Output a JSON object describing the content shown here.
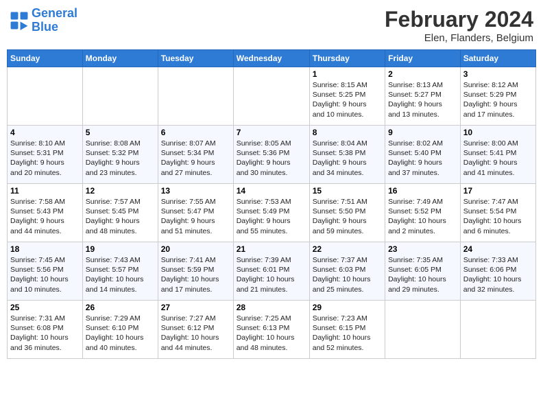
{
  "header": {
    "logo_line1": "General",
    "logo_line2": "Blue",
    "month": "February 2024",
    "location": "Elen, Flanders, Belgium"
  },
  "days_of_week": [
    "Sunday",
    "Monday",
    "Tuesday",
    "Wednesday",
    "Thursday",
    "Friday",
    "Saturday"
  ],
  "weeks": [
    [
      {
        "day": "",
        "info": ""
      },
      {
        "day": "",
        "info": ""
      },
      {
        "day": "",
        "info": ""
      },
      {
        "day": "",
        "info": ""
      },
      {
        "day": "1",
        "info": "Sunrise: 8:15 AM\nSunset: 5:25 PM\nDaylight: 9 hours\nand 10 minutes."
      },
      {
        "day": "2",
        "info": "Sunrise: 8:13 AM\nSunset: 5:27 PM\nDaylight: 9 hours\nand 13 minutes."
      },
      {
        "day": "3",
        "info": "Sunrise: 8:12 AM\nSunset: 5:29 PM\nDaylight: 9 hours\nand 17 minutes."
      }
    ],
    [
      {
        "day": "4",
        "info": "Sunrise: 8:10 AM\nSunset: 5:31 PM\nDaylight: 9 hours\nand 20 minutes."
      },
      {
        "day": "5",
        "info": "Sunrise: 8:08 AM\nSunset: 5:32 PM\nDaylight: 9 hours\nand 23 minutes."
      },
      {
        "day": "6",
        "info": "Sunrise: 8:07 AM\nSunset: 5:34 PM\nDaylight: 9 hours\nand 27 minutes."
      },
      {
        "day": "7",
        "info": "Sunrise: 8:05 AM\nSunset: 5:36 PM\nDaylight: 9 hours\nand 30 minutes."
      },
      {
        "day": "8",
        "info": "Sunrise: 8:04 AM\nSunset: 5:38 PM\nDaylight: 9 hours\nand 34 minutes."
      },
      {
        "day": "9",
        "info": "Sunrise: 8:02 AM\nSunset: 5:40 PM\nDaylight: 9 hours\nand 37 minutes."
      },
      {
        "day": "10",
        "info": "Sunrise: 8:00 AM\nSunset: 5:41 PM\nDaylight: 9 hours\nand 41 minutes."
      }
    ],
    [
      {
        "day": "11",
        "info": "Sunrise: 7:58 AM\nSunset: 5:43 PM\nDaylight: 9 hours\nand 44 minutes."
      },
      {
        "day": "12",
        "info": "Sunrise: 7:57 AM\nSunset: 5:45 PM\nDaylight: 9 hours\nand 48 minutes."
      },
      {
        "day": "13",
        "info": "Sunrise: 7:55 AM\nSunset: 5:47 PM\nDaylight: 9 hours\nand 51 minutes."
      },
      {
        "day": "14",
        "info": "Sunrise: 7:53 AM\nSunset: 5:49 PM\nDaylight: 9 hours\nand 55 minutes."
      },
      {
        "day": "15",
        "info": "Sunrise: 7:51 AM\nSunset: 5:50 PM\nDaylight: 9 hours\nand 59 minutes."
      },
      {
        "day": "16",
        "info": "Sunrise: 7:49 AM\nSunset: 5:52 PM\nDaylight: 10 hours\nand 2 minutes."
      },
      {
        "day": "17",
        "info": "Sunrise: 7:47 AM\nSunset: 5:54 PM\nDaylight: 10 hours\nand 6 minutes."
      }
    ],
    [
      {
        "day": "18",
        "info": "Sunrise: 7:45 AM\nSunset: 5:56 PM\nDaylight: 10 hours\nand 10 minutes."
      },
      {
        "day": "19",
        "info": "Sunrise: 7:43 AM\nSunset: 5:57 PM\nDaylight: 10 hours\nand 14 minutes."
      },
      {
        "day": "20",
        "info": "Sunrise: 7:41 AM\nSunset: 5:59 PM\nDaylight: 10 hours\nand 17 minutes."
      },
      {
        "day": "21",
        "info": "Sunrise: 7:39 AM\nSunset: 6:01 PM\nDaylight: 10 hours\nand 21 minutes."
      },
      {
        "day": "22",
        "info": "Sunrise: 7:37 AM\nSunset: 6:03 PM\nDaylight: 10 hours\nand 25 minutes."
      },
      {
        "day": "23",
        "info": "Sunrise: 7:35 AM\nSunset: 6:05 PM\nDaylight: 10 hours\nand 29 minutes."
      },
      {
        "day": "24",
        "info": "Sunrise: 7:33 AM\nSunset: 6:06 PM\nDaylight: 10 hours\nand 32 minutes."
      }
    ],
    [
      {
        "day": "25",
        "info": "Sunrise: 7:31 AM\nSunset: 6:08 PM\nDaylight: 10 hours\nand 36 minutes."
      },
      {
        "day": "26",
        "info": "Sunrise: 7:29 AM\nSunset: 6:10 PM\nDaylight: 10 hours\nand 40 minutes."
      },
      {
        "day": "27",
        "info": "Sunrise: 7:27 AM\nSunset: 6:12 PM\nDaylight: 10 hours\nand 44 minutes."
      },
      {
        "day": "28",
        "info": "Sunrise: 7:25 AM\nSunset: 6:13 PM\nDaylight: 10 hours\nand 48 minutes."
      },
      {
        "day": "29",
        "info": "Sunrise: 7:23 AM\nSunset: 6:15 PM\nDaylight: 10 hours\nand 52 minutes."
      },
      {
        "day": "",
        "info": ""
      },
      {
        "day": "",
        "info": ""
      }
    ]
  ]
}
